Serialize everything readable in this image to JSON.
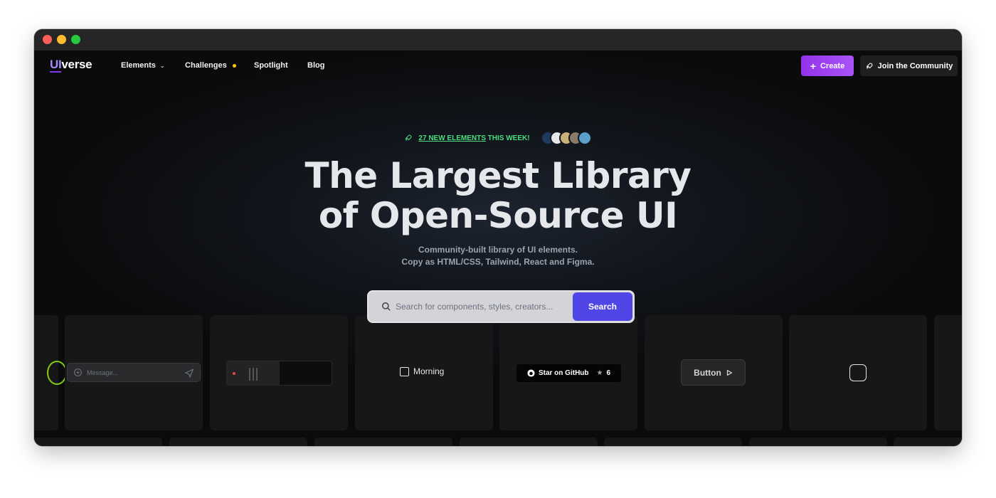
{
  "nav": {
    "logo_ui": "UI",
    "logo_rest": "verse",
    "items": [
      {
        "label": "Elements"
      },
      {
        "label": "Challenges"
      },
      {
        "label": "Spotlight"
      },
      {
        "label": "Blog"
      }
    ],
    "create_label": "Create",
    "join_label": "Join the Community"
  },
  "hero": {
    "badge_link": "27 NEW ELEMENTS",
    "badge_rest": " THIS WEEK!",
    "title_line1": "The Largest Library",
    "title_line2": "of Open-Source UI",
    "subtitle_line1": "Community-built library of UI elements.",
    "subtitle_line2": "Copy as HTML/CSS, Tailwind, React and Figma."
  },
  "search": {
    "placeholder": "Search for components, styles, creators...",
    "button_label": "Search"
  },
  "cards": {
    "message_placeholder": "Message...",
    "checkbox_label": "Morning",
    "github_label": "Star on GitHub",
    "github_stars": "6",
    "button_label": "Button"
  },
  "colors": {
    "accent": "#4f46e5",
    "create": "#a855f7",
    "badge": "#4ade80",
    "challenge_dot": "#facc15",
    "avatars": [
      "#1e3a5f",
      "#e5e7eb",
      "#c9b27a",
      "#8a7a6a",
      "#5aa0c8"
    ]
  }
}
